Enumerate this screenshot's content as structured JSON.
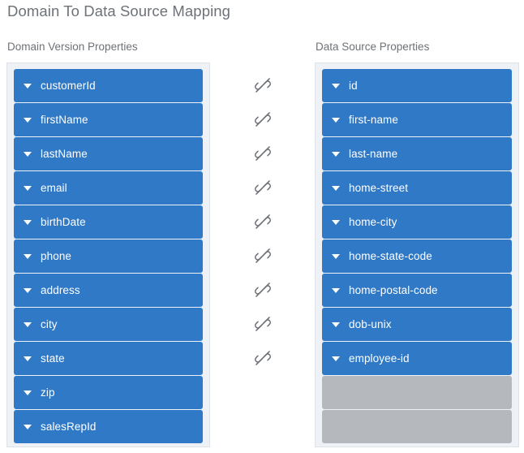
{
  "page": {
    "title": "Domain To Data Source Mapping",
    "background": "#ffffff",
    "title_color": "#6d7278"
  },
  "colors": {
    "row_blue": "#3079c6",
    "row_placeholder_gray": "#b5b9bd",
    "panel_background": "#eef1f5",
    "panel_border": "#dfe3e8",
    "row_text": "#ffffff",
    "icon_gray": "#6d7278"
  },
  "left_panel": {
    "header": "Domain Version Properties",
    "items": [
      {
        "label": "customerId",
        "state": "blue",
        "icon": "caret-down-icon"
      },
      {
        "label": "firstName",
        "state": "blue",
        "icon": "caret-down-icon"
      },
      {
        "label": "lastName",
        "state": "blue",
        "icon": "caret-down-icon"
      },
      {
        "label": "email",
        "state": "blue",
        "icon": "caret-down-icon"
      },
      {
        "label": "birthDate",
        "state": "blue",
        "icon": "caret-down-icon"
      },
      {
        "label": "phone",
        "state": "blue",
        "icon": "caret-down-icon"
      },
      {
        "label": "address",
        "state": "blue",
        "icon": "caret-down-icon"
      },
      {
        "label": "city",
        "state": "blue",
        "icon": "caret-down-icon"
      },
      {
        "label": "state",
        "state": "blue",
        "icon": "caret-down-icon"
      },
      {
        "label": "zip",
        "state": "blue",
        "icon": "caret-down-icon"
      },
      {
        "label": "salesRepId",
        "state": "blue",
        "icon": "caret-down-icon"
      }
    ]
  },
  "right_panel": {
    "header": "Data Source Properties",
    "items": [
      {
        "label": "id",
        "state": "blue",
        "icon": "caret-down-icon"
      },
      {
        "label": "first-name",
        "state": "blue",
        "icon": "caret-down-icon"
      },
      {
        "label": "last-name",
        "state": "blue",
        "icon": "caret-down-icon"
      },
      {
        "label": "home-street",
        "state": "blue",
        "icon": "caret-down-icon"
      },
      {
        "label": "home-city",
        "state": "blue",
        "icon": "caret-down-icon"
      },
      {
        "label": "home-state-code",
        "state": "blue",
        "icon": "caret-down-icon"
      },
      {
        "label": "home-postal-code",
        "state": "blue",
        "icon": "caret-down-icon"
      },
      {
        "label": "dob-unix",
        "state": "blue",
        "icon": "caret-down-icon"
      },
      {
        "label": "employee-id",
        "state": "blue",
        "icon": "caret-down-icon"
      },
      {
        "label": "",
        "state": "placeholder",
        "icon": ""
      },
      {
        "label": "",
        "state": "placeholder",
        "icon": ""
      }
    ]
  },
  "mapping_links": {
    "icon": "unlink-icon",
    "count": 9,
    "slots": [
      {
        "icon": "unlink-icon"
      },
      {
        "icon": "unlink-icon"
      },
      {
        "icon": "unlink-icon"
      },
      {
        "icon": "unlink-icon"
      },
      {
        "icon": "unlink-icon"
      },
      {
        "icon": "unlink-icon"
      },
      {
        "icon": "unlink-icon"
      },
      {
        "icon": "unlink-icon"
      },
      {
        "icon": "unlink-icon"
      }
    ]
  }
}
